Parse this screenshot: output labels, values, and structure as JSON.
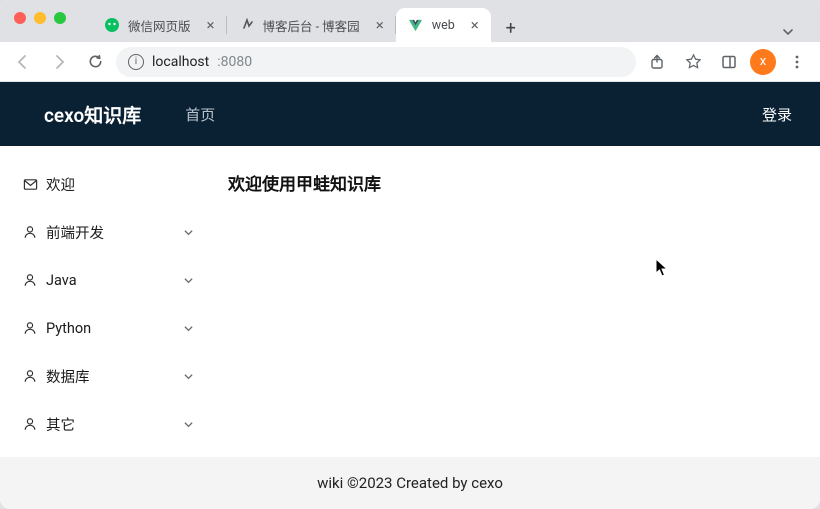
{
  "browser": {
    "tabs": [
      {
        "title": "微信网页版"
      },
      {
        "title": "博客后台 - 博客园"
      },
      {
        "title": "web"
      }
    ],
    "url_host": "localhost",
    "url_port": ":8080",
    "avatar_letter": "x"
  },
  "nav": {
    "brand": "cexo知识库",
    "home": "首页",
    "login": "登录"
  },
  "sidebar": {
    "items": [
      {
        "label": "欢迎",
        "icon": "mail",
        "expandable": false
      },
      {
        "label": "前端开发",
        "icon": "user",
        "expandable": true
      },
      {
        "label": "Java",
        "icon": "user",
        "expandable": true
      },
      {
        "label": "Python",
        "icon": "user",
        "expandable": true
      },
      {
        "label": "数据库",
        "icon": "user",
        "expandable": true
      },
      {
        "label": "其它",
        "icon": "user",
        "expandable": true
      }
    ]
  },
  "main": {
    "heading": "欢迎使用甲蛙知识库"
  },
  "footer": {
    "text": "wiki ©2023 Created by cexo"
  }
}
